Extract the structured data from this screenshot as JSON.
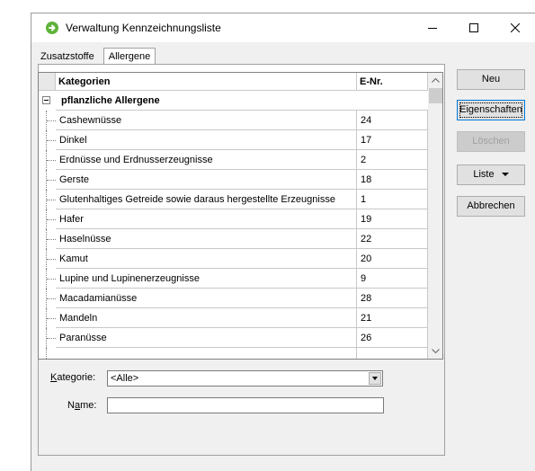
{
  "window": {
    "title": "Verwaltung Kennzeichnungsliste",
    "icon": "green-arrow-circle-icon"
  },
  "tabs": [
    {
      "label": "Zusatzstoffe",
      "active": false
    },
    {
      "label": "Allergene",
      "active": true
    }
  ],
  "grid": {
    "headers": {
      "category": "Kategorien",
      "enr": "E-Nr."
    },
    "group": "pflanzliche Allergene",
    "rows": [
      {
        "category": "Cashewnüsse",
        "enr": "24"
      },
      {
        "category": "Dinkel",
        "enr": "17"
      },
      {
        "category": "Erdnüsse und Erdnusserzeugnisse",
        "enr": "2"
      },
      {
        "category": "Gerste",
        "enr": "18"
      },
      {
        "category": "Glutenhaltiges Getreide sowie daraus hergestellte Erzeugnisse",
        "enr": "1"
      },
      {
        "category": "Hafer",
        "enr": "19"
      },
      {
        "category": "Haselnüsse",
        "enr": "22"
      },
      {
        "category": "Kamut",
        "enr": "20"
      },
      {
        "category": "Lupine und Lupinenerzeugnisse",
        "enr": "9"
      },
      {
        "category": "Macadamianüsse",
        "enr": "28"
      },
      {
        "category": "Mandeln",
        "enr": "21"
      },
      {
        "category": "Paranüsse",
        "enr": "26"
      }
    ]
  },
  "buttons": {
    "new": "Neu",
    "properties": "Eigenschaften",
    "delete": "Löschen",
    "list": "Liste",
    "cancel": "Abbrechen"
  },
  "filters": {
    "category_label_first": "K",
    "category_label_rest": "ategorie:",
    "category_value": "<Alle>",
    "name_label_first": "N",
    "name_label_mid": "a",
    "name_label_rest": "me:",
    "name_value": ""
  },
  "colors": {
    "accent": "#0078d7",
    "icon_green": "#5fb23a"
  }
}
